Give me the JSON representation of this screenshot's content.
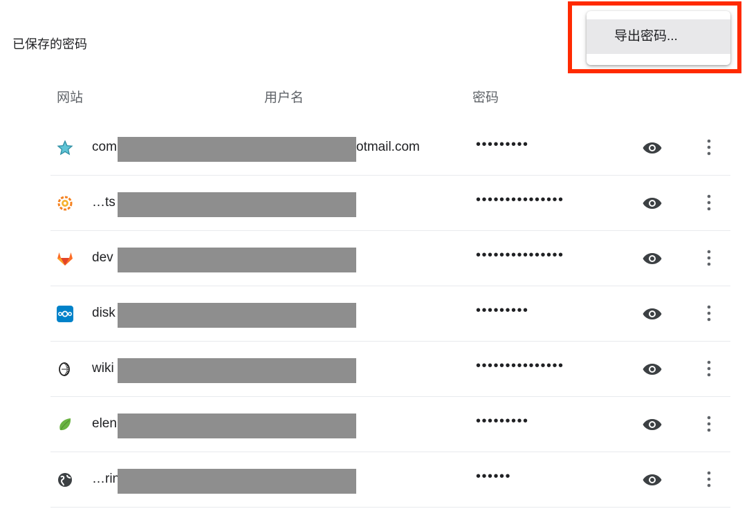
{
  "section": {
    "title": "已保存的密码"
  },
  "columns": {
    "site": "网站",
    "username": "用户名",
    "password": "密码"
  },
  "menu": {
    "export_label": "导出密码..."
  },
  "colors": {
    "highlight": "#ff2a00",
    "redaction": "#8e8e8e"
  },
  "rows": [
    {
      "icon": "star-icon",
      "site": "com",
      "user_suffix": "otmail.com",
      "password": "•••••••••"
    },
    {
      "icon": "grafana-icon",
      "site": "…ts",
      "user_suffix": "",
      "password": "•••••••••••••••"
    },
    {
      "icon": "gitlab-icon",
      "site": "dev",
      "user_suffix": "",
      "password": "•••••••••••••••"
    },
    {
      "icon": "nextcloud-icon",
      "site": "disk",
      "user_suffix": "",
      "password": "•••••••••"
    },
    {
      "icon": "wiki-icon",
      "site": "wiki",
      "user_suffix": "",
      "password": "•••••••••••••••"
    },
    {
      "icon": "element-icon",
      "site": "elen",
      "user_suffix": "",
      "password": "•••••••••"
    },
    {
      "icon": "globe-icon",
      "site": "…rin",
      "user_suffix": "",
      "password": "••••••"
    }
  ]
}
